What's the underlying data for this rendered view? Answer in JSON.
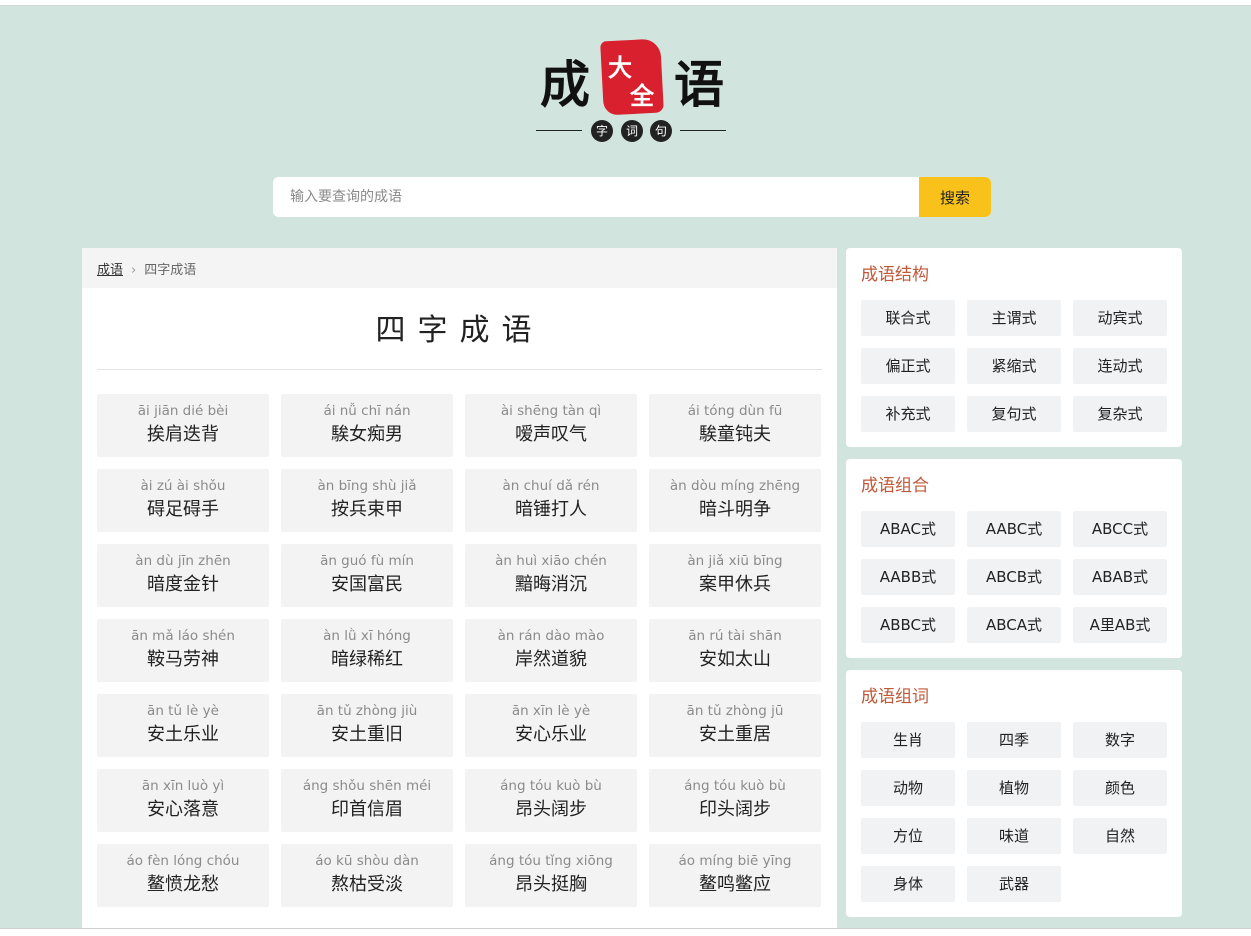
{
  "logo": {
    "left_char": "成",
    "seal_chars": [
      "大",
      "全"
    ],
    "right_char": "语",
    "sub_chars": [
      "字",
      "词",
      "句"
    ]
  },
  "search": {
    "placeholder": "输入要查询的成语",
    "button_label": "搜索"
  },
  "breadcrumb": {
    "home": "成语",
    "current": "四字成语"
  },
  "page_title": "四字成语",
  "idioms": [
    {
      "pinyin": "āi jiān dié bèi",
      "word": "挨肩迭背"
    },
    {
      "pinyin": "ái nǚ chī nán",
      "word": "騃女痴男"
    },
    {
      "pinyin": "ài shēng tàn qì",
      "word": "嗳声叹气"
    },
    {
      "pinyin": "ái tóng dùn fū",
      "word": "騃童钝夫"
    },
    {
      "pinyin": "ài zú ài shǒu",
      "word": "碍足碍手"
    },
    {
      "pinyin": "àn bīng shù jiǎ",
      "word": "按兵束甲"
    },
    {
      "pinyin": "àn chuí dǎ rén",
      "word": "暗锤打人"
    },
    {
      "pinyin": "àn dòu míng zhēng",
      "word": "暗斗明争"
    },
    {
      "pinyin": "àn dù jīn zhēn",
      "word": "暗度金针"
    },
    {
      "pinyin": "ān guó fù mín",
      "word": "安国富民"
    },
    {
      "pinyin": "àn huì xiāo chén",
      "word": "黯晦消沉"
    },
    {
      "pinyin": "àn jiǎ xiū bīng",
      "word": "案甲休兵"
    },
    {
      "pinyin": "ān mǎ láo shén",
      "word": "鞍马劳神"
    },
    {
      "pinyin": "àn lǜ xī hóng",
      "word": "暗绿稀红"
    },
    {
      "pinyin": "àn rán dào mào",
      "word": "岸然道貌"
    },
    {
      "pinyin": "ān rú tài shān",
      "word": "安如太山"
    },
    {
      "pinyin": "ān tǔ lè yè",
      "word": "安土乐业"
    },
    {
      "pinyin": "ān tǔ zhòng jiù",
      "word": "安土重旧"
    },
    {
      "pinyin": "ān xīn lè yè",
      "word": "安心乐业"
    },
    {
      "pinyin": "ān tǔ zhòng jū",
      "word": "安土重居"
    },
    {
      "pinyin": "ān xīn luò yì",
      "word": "安心落意"
    },
    {
      "pinyin": "áng shǒu shēn méi",
      "word": "印首信眉"
    },
    {
      "pinyin": "áng tóu kuò bù",
      "word": "昂头阔步"
    },
    {
      "pinyin": "áng tóu kuò bù",
      "word": "印头阔步"
    },
    {
      "pinyin": "áo fèn lóng chóu",
      "word": "鳌愤龙愁"
    },
    {
      "pinyin": "áo kū shòu dàn",
      "word": "熬枯受淡"
    },
    {
      "pinyin": "áng tóu tǐng xiōng",
      "word": "昂头挺胸"
    },
    {
      "pinyin": "áo míng biē yīng",
      "word": "鳌鸣鳖应"
    }
  ],
  "structure_panel": {
    "title": "成语结构",
    "tags": [
      "联合式",
      "主谓式",
      "动宾式",
      "偏正式",
      "紧缩式",
      "连动式",
      "补充式",
      "复句式",
      "复杂式"
    ]
  },
  "combo_panel": {
    "title": "成语组合",
    "tags": [
      "ABAC式",
      "AABC式",
      "ABCC式",
      "AABB式",
      "ABCB式",
      "ABAB式",
      "ABBC式",
      "ABCA式",
      "A里AB式"
    ]
  },
  "word_panel": {
    "title": "成语组词",
    "tags": [
      "生肖",
      "四季",
      "数字",
      "动物",
      "植物",
      "颜色",
      "方位",
      "味道",
      "自然",
      "身体",
      "武器"
    ]
  }
}
